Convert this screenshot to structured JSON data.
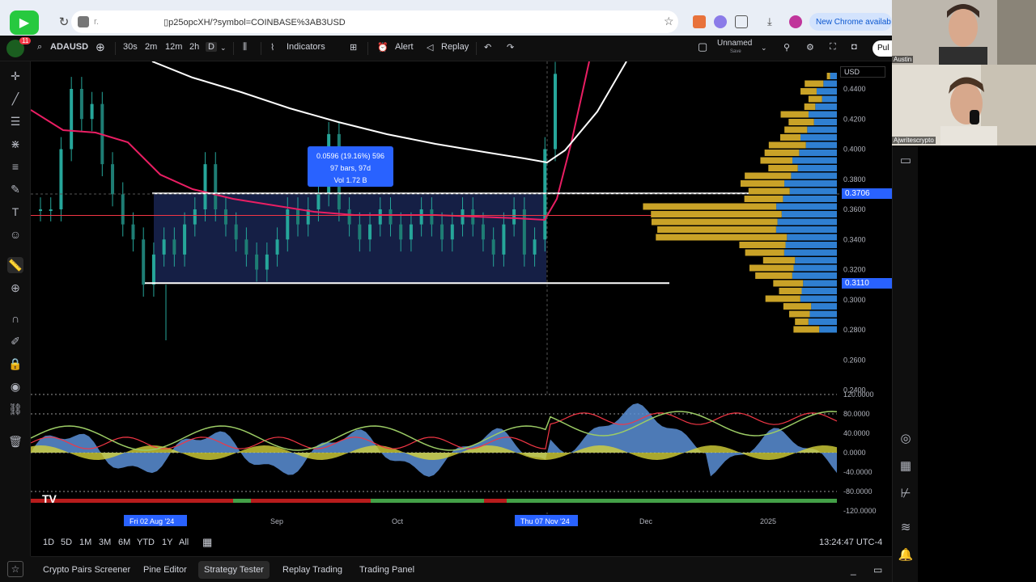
{
  "browser": {
    "url": "▯p25opcXH/?symbol=COINBASE%3AB3USD",
    "url_prefix": "r.",
    "stream_brand": "studio",
    "new_chrome_label": "New Chrome availab"
  },
  "toolbar": {
    "symbol": "ADAUSD",
    "intervals": [
      "30s",
      "2m",
      "12m",
      "2h",
      "D"
    ],
    "indicators_label": "Indicators",
    "alert_label": "Alert",
    "replay_label": "Replay",
    "layout_name": "Unnamed",
    "layout_sub": "Save",
    "publish_label": "Pul",
    "notification_count": "11"
  },
  "price_axis": {
    "currency": "USD",
    "ticks": [
      "0.4400",
      "0.4200",
      "0.4000",
      "0.3800",
      "0.3600",
      "0.3400",
      "0.3200",
      "0.3000",
      "0.2800",
      "0.2600",
      "0.2400"
    ],
    "tag_upper": "0.3706",
    "tag_lower": "0.3110"
  },
  "osc_axis": {
    "ticks": [
      "120.0000",
      "80.0000",
      "40.0000",
      "0.0000",
      "-40.0000",
      "-80.0000",
      "-120.0000"
    ]
  },
  "time_axis": {
    "labels": [
      "Fri 02 Aug '24",
      "Sep",
      "Oct",
      "Thu 07 Nov '24",
      "Dec",
      "2025"
    ]
  },
  "measure_box": {
    "line1": "0.0596 (19.16%) 596",
    "line2": "97 bars, 97d",
    "line3": "Vol 1.72 B"
  },
  "range_bar": {
    "ranges": [
      "1D",
      "5D",
      "1M",
      "3M",
      "6M",
      "YTD",
      "1Y",
      "All"
    ],
    "clock": "13:24:47 UTC-4"
  },
  "bottom_tabs": [
    "Crypto Pairs Screener",
    "Pine Editor",
    "Strategy Tester",
    "Replay Trading",
    "Trading Panel"
  ],
  "webcams": {
    "top_name": "Austin",
    "bottom_name": "Ajwritescrypto"
  },
  "chart_data": {
    "type": "candlestick",
    "symbol": "ADAUSD",
    "timeframe": "D",
    "ylim": [
      0.24,
      0.45
    ],
    "range_box": {
      "top": 0.3706,
      "bottom": 0.311,
      "change": 0.0596,
      "change_pct": 19.16,
      "bars": 97
    },
    "close_path": [
      0.36,
      0.36,
      0.4,
      0.44,
      0.42,
      0.43,
      0.39,
      0.37,
      0.35,
      0.34,
      0.31,
      0.33,
      0.34,
      0.33,
      0.35,
      0.36,
      0.39,
      0.36,
      0.35,
      0.34,
      0.33,
      0.32,
      0.33,
      0.34,
      0.36,
      0.35,
      0.36,
      0.37,
      0.41,
      0.36,
      0.35,
      0.34,
      0.35,
      0.36,
      0.35,
      0.34,
      0.35,
      0.36,
      0.35,
      0.34,
      0.35,
      0.36,
      0.35,
      0.34,
      0.33,
      0.35,
      0.36,
      0.33,
      0.34,
      0.4,
      0.45
    ]
  },
  "colors": {
    "accent": "#2962ff",
    "ma_pink": "#e91e63",
    "ma_white": "#ffffff",
    "candle": "#26a69a",
    "volume_profile_gold": "#c9a227",
    "volume_profile_blue": "#2f7fd1",
    "selection_fill": "#1c2a5c"
  }
}
